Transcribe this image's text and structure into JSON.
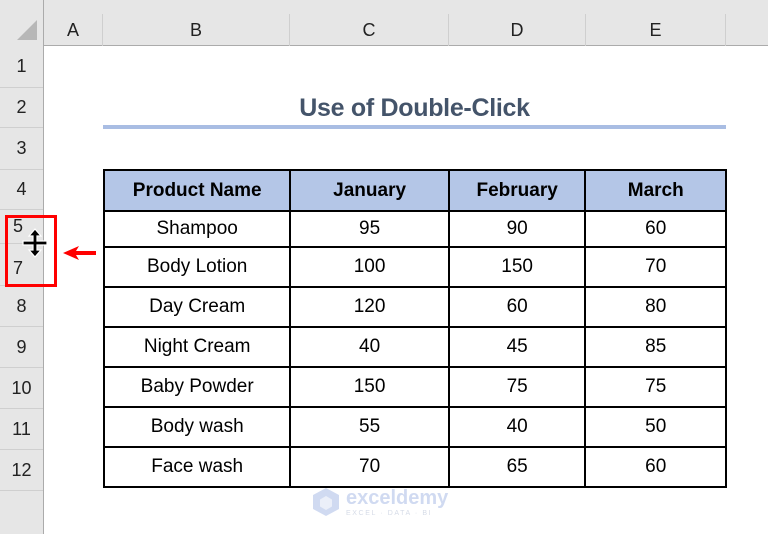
{
  "spreadsheet": {
    "columns": [
      "A",
      "B",
      "C",
      "D",
      "E"
    ],
    "rows": [
      "1",
      "2",
      "3",
      "4",
      "5",
      "7",
      "8",
      "9",
      "10",
      "11",
      "12"
    ]
  },
  "title": "Use of Double-Click",
  "table": {
    "headers": [
      "Product Name",
      "January",
      "February",
      "March"
    ],
    "rows": [
      [
        "Shampoo",
        "95",
        "90",
        "60"
      ],
      [
        "Body Lotion",
        "100",
        "150",
        "70"
      ],
      [
        "Day Cream",
        "120",
        "60",
        "80"
      ],
      [
        "Night Cream",
        "40",
        "45",
        "85"
      ],
      [
        "Baby Powder",
        "150",
        "75",
        "75"
      ],
      [
        "Body wash",
        "55",
        "40",
        "50"
      ],
      [
        "Face wash",
        "70",
        "65",
        "60"
      ]
    ]
  },
  "annotation": {
    "highlight_color": "#ff0000",
    "cursor": "row-resize-cursor",
    "arrow": "left-arrow"
  },
  "watermark": {
    "name": "exceldemy",
    "tagline": "EXCEL · DATA · BI"
  },
  "colors": {
    "header_fill": "#b4c6e7",
    "title_color": "#44546a",
    "underline": "#a9bde3"
  }
}
